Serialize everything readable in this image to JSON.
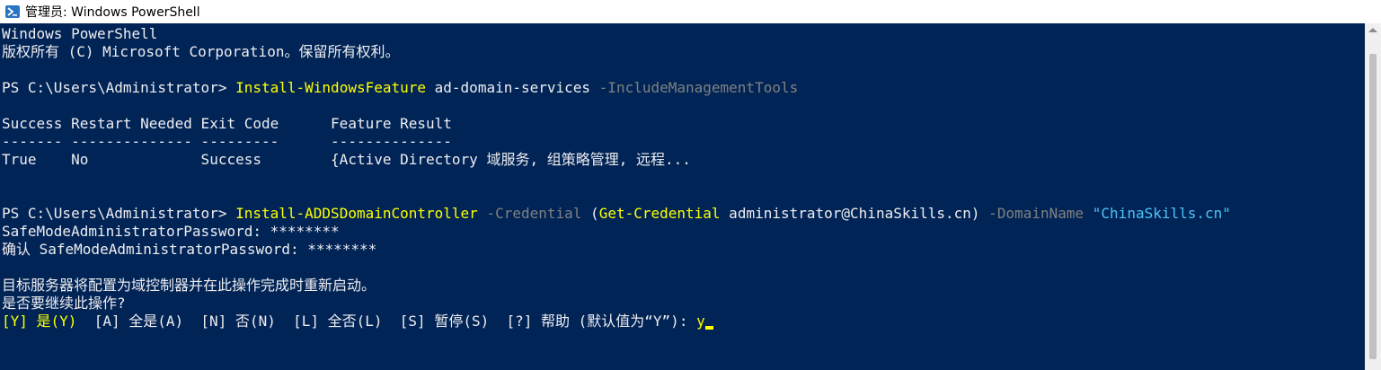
{
  "window": {
    "title": "管理员: Windows PowerShell",
    "icon": "powershell-icon"
  },
  "console": {
    "banner1": "Windows PowerShell",
    "banner2": "版权所有 (C) Microsoft Corporation。保留所有权利。",
    "cmd1": {
      "prompt": "PS C:\\Users\\Administrator> ",
      "command": "Install-WindowsFeature",
      "arg1": " ad-domain-services ",
      "param1": "-IncludeManagementTools"
    },
    "table": {
      "header": "Success Restart Needed Exit Code      Feature Result",
      "separator": "------- -------------- ---------      --------------",
      "row": "True    No             Success        {Active Directory 域服务, 组策略管理, 远程..."
    },
    "cmd2": {
      "prompt": "PS C:\\Users\\Administrator> ",
      "command": "Install-ADDSDomainController",
      "p1": " -Credential ",
      "paren_open": "(",
      "inner_cmd": "Get-Credential",
      "inner_arg": " administrator@ChinaSkills.cn",
      "paren_close": ")",
      "p2": " -DomainName ",
      "string_val": "\"ChinaSkills.cn\""
    },
    "pw1": "SafeModeAdministratorPassword: ********",
    "pw2": "确认 SafeModeAdministratorPassword: ********",
    "msg1": "目标服务器将配置为域控制器并在此操作完成时重新启动。",
    "msg2": "是否要继续此操作?",
    "choice_y": "[Y] 是(Y)",
    "choices_rest": "  [A] 全是(A)  [N] 否(N)  [L] 全否(L)  [S] 暂停(S)  [?] 帮助 (默认值为“Y”): ",
    "input": "y"
  },
  "colors": {
    "background": "#012456",
    "foreground": "#EEEDF0",
    "command": "#FFFF00",
    "parameter": "#808080",
    "string": "#4FC3F7"
  }
}
